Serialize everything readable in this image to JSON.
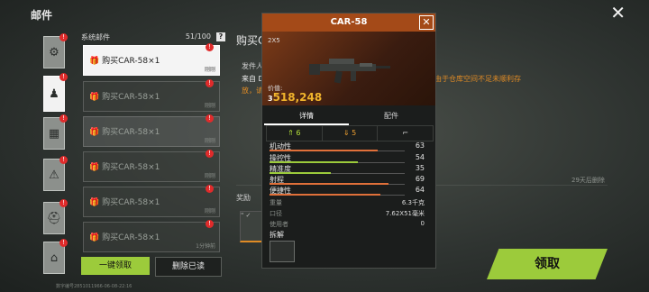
{
  "header": {
    "title": "邮件",
    "close_glyph": "✕"
  },
  "categories": [
    {
      "icon": "gear-icon",
      "glyph": "⚙",
      "badge": "!"
    },
    {
      "icon": "poster-icon",
      "glyph": "♟",
      "badge": "!"
    },
    {
      "icon": "cubes-icon",
      "glyph": "▦",
      "badge": "!"
    },
    {
      "icon": "warning-icon",
      "glyph": "⚠",
      "badge": "!"
    },
    {
      "icon": "helmet-icon",
      "glyph": "⛑",
      "badge": "!"
    },
    {
      "icon": "bag-icon",
      "glyph": "⌂",
      "badge": "!"
    }
  ],
  "mail_list": {
    "header": "系统邮件",
    "count": "51/100",
    "help": "?",
    "items": [
      {
        "title": "购买CAR-58×1",
        "time": "刚刚",
        "badge": "!"
      },
      {
        "title": "购买CAR-58×1",
        "time": "刚刚",
        "badge": "!"
      },
      {
        "title": "购买CAR-58×1",
        "time": "刚刚",
        "badge": "!"
      },
      {
        "title": "购买CAR-58×1",
        "time": "刚刚",
        "badge": "!"
      },
      {
        "title": "购买CAR-58×1",
        "time": "刚刚",
        "badge": "!"
      },
      {
        "title": "购买CAR-58×1",
        "time": "1分钟前",
        "badge": "!"
      }
    ],
    "claim_all": "一键领取",
    "delete_read": "删除已读"
  },
  "footer_id": "数字编号2851011966-06-08-22:16",
  "detail": {
    "title": "购买C",
    "from": "发件人",
    "body_line1": "来自 D",
    "body_line2": "放，请",
    "body_right": "由于仓库空间不足未顺利存",
    "expire": "29天后删除",
    "reward_label": "奖励",
    "reward_slot": "\" ✓",
    "claim": "领取"
  },
  "popup": {
    "title": "CAR-58",
    "close_glyph": "✕",
    "size": "2X5",
    "price_label": "价值:",
    "price": "518,248",
    "price_prefix": "3",
    "tabs": [
      "详情",
      "配件"
    ],
    "stats": [
      {
        "icon": "chevrons-up-icon",
        "glyph": "≫",
        "value": "6",
        "color": "#b6e23a"
      },
      {
        "icon": "chevrons-down-icon",
        "glyph": "≫",
        "value": "5",
        "color": "#f0a030"
      },
      {
        "icon": "gun-icon",
        "glyph": "⌐",
        "value": "",
        "color": "#e6e6e6"
      }
    ],
    "attributes": [
      {
        "label": "机动性",
        "value": "63",
        "fill": 0.8,
        "color": "#e0703a"
      },
      {
        "label": "操控性",
        "value": "54",
        "fill": 0.65,
        "color": "#9ccb3b"
      },
      {
        "label": "精准度",
        "value": "35",
        "fill": 0.45,
        "color": "#9ccb3b"
      },
      {
        "label": "射程",
        "value": "69",
        "fill": 0.88,
        "color": "#e0703a"
      },
      {
        "label": "便捷性",
        "value": "64",
        "fill": 0.82,
        "color": "#e0703a"
      }
    ],
    "specs": [
      {
        "label": "重量",
        "value": "6.3千克"
      },
      {
        "label": "口径",
        "value": "7.62X51毫米"
      },
      {
        "label": "使用者",
        "value": "0"
      }
    ],
    "disassemble": "拆解"
  }
}
